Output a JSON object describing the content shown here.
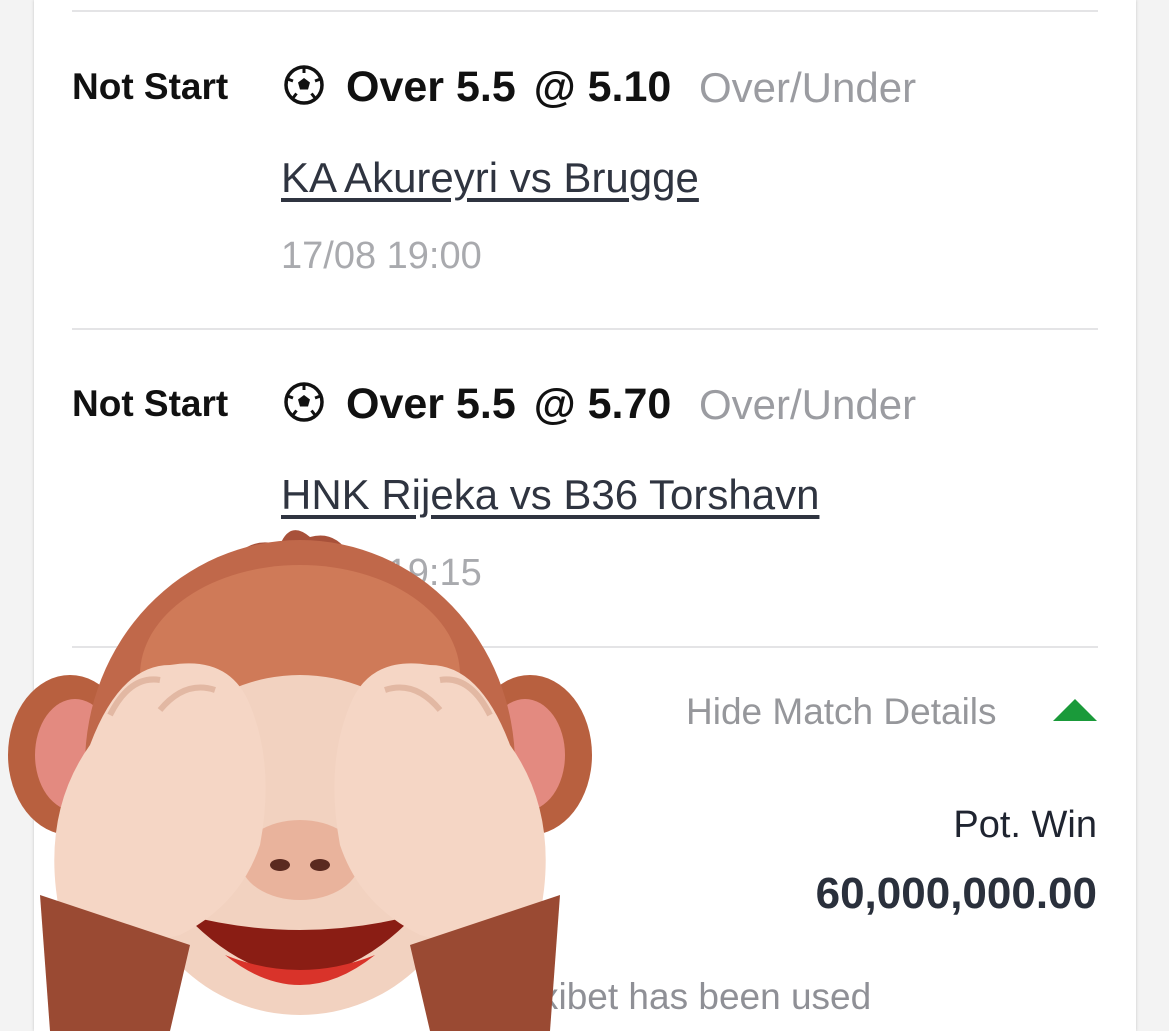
{
  "bets": [
    {
      "status": "Not Start",
      "selection": "Over 5.5",
      "odds": "@ 5.10",
      "market": "Over/Under",
      "match": "KA Akureyri vs Brugge",
      "kickoff": "17/08 19:00",
      "sport_icon": "soccer-ball-icon"
    },
    {
      "status": "Not Start",
      "selection": "Over 5.5",
      "odds": "@ 5.70",
      "market": "Over/Under",
      "match": "HNK Rijeka vs B36 Torshavn",
      "kickoff": "17/08 19:15",
      "sport_icon": "soccer-ball-icon"
    }
  ],
  "details_toggle": {
    "label": "Hide Match Details",
    "icon": "triangle-up-icon",
    "color": "#1a9a3a"
  },
  "summary": {
    "pot_win_label": "Pot. Win",
    "pot_win_value": "60,000,000.00"
  },
  "footnote": "xibet has been used",
  "overlay": {
    "icon": "see-no-evil-monkey-emoji"
  }
}
